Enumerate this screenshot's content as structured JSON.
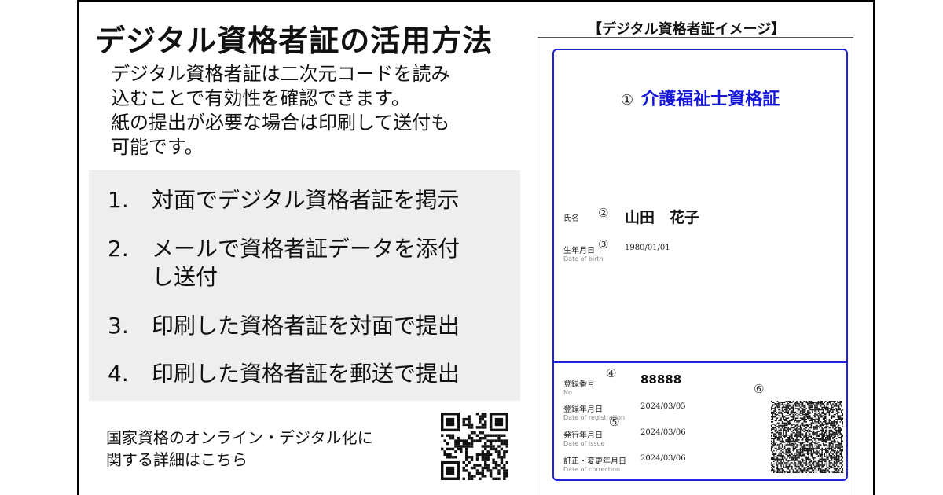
{
  "left": {
    "title": "デジタル資格者証の活用方法",
    "description": [
      "デジタル資格者証は二次元コードを読み",
      "込むことで有効性を確認できます。",
      "紙の提出が必要な場合は印刷して送付も",
      "可能です。"
    ],
    "steps": [
      {
        "num": "1.",
        "lines": [
          "対面でデジタル資格者証を掲示"
        ]
      },
      {
        "num": "2.",
        "lines": [
          "メールで資格者証データを添付",
          "し送付"
        ]
      },
      {
        "num": "3.",
        "lines": [
          "印刷した資格者証を対面で提出"
        ]
      },
      {
        "num": "4.",
        "lines": [
          "印刷した資格者証を郵送で提出"
        ]
      }
    ],
    "footer": [
      "国家資格のオンライン・デジタル化に",
      "関する詳細はこちら"
    ]
  },
  "card": {
    "caption": "【デジタル資格者証イメージ】",
    "title_marker": "①",
    "title": "介護福祉士資格証",
    "name": {
      "marker": "②",
      "label": "氏名",
      "value": "山田　花子"
    },
    "birth": {
      "marker": "③",
      "label": "生年月日",
      "label_en": "Date of birth",
      "value": "1980/01/01"
    },
    "reg_no": {
      "marker": "④",
      "label": "登録番号",
      "label_en": "No",
      "value": "88888"
    },
    "dates_marker": "⑤",
    "qr_marker": "⑥",
    "reg_date": {
      "label": "登録年月日",
      "label_en": "Date of registration",
      "value": "2024/03/05"
    },
    "issue_date": {
      "label": "発行年月日",
      "label_en": "Date of issue",
      "value": "2024/03/06"
    },
    "correction_date": {
      "label": "訂正・変更年月日",
      "label_en": "Date of correction",
      "value": "2024/03/06"
    }
  },
  "icons": {
    "small_qr": "qr-code-icon",
    "card_qr": "qr-code-icon"
  }
}
